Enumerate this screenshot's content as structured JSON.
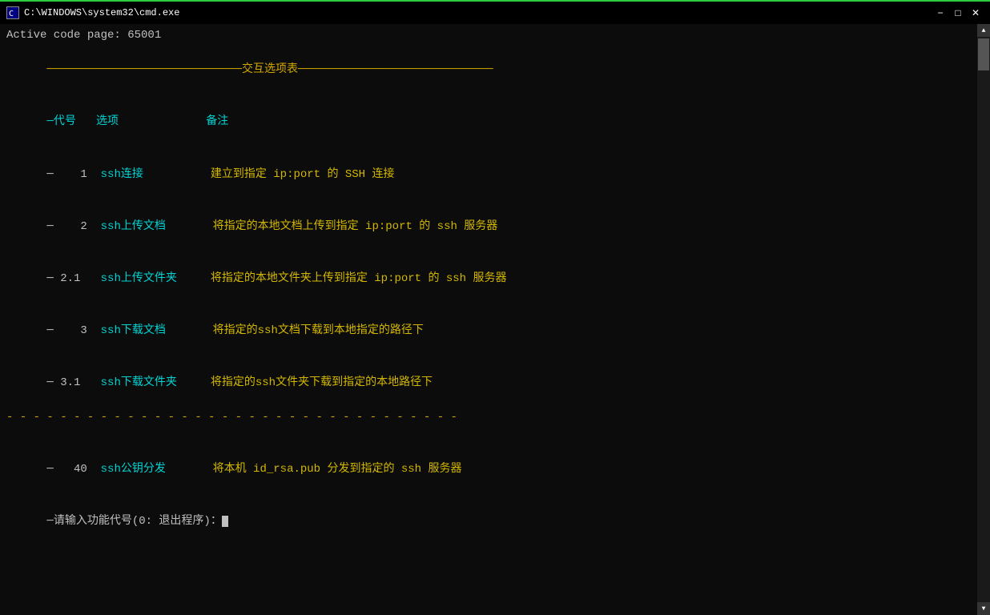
{
  "titlebar": {
    "title": "C:\\WINDOWS\\system32\\cmd.exe",
    "icon_label": "C",
    "minimize_label": "−",
    "restore_label": "□",
    "close_label": "✕"
  },
  "terminal": {
    "active_code": "Active code page: 65001",
    "menu_title": "─────────────────────────────交互选项表─────────────────────────────",
    "header_row": "─代号   选项             备注",
    "rows": [
      {
        "code": "─    1",
        "option": "ssh连接",
        "desc": "建立到指定 ip:port 的 SSH 连接"
      },
      {
        "code": "─    2",
        "option": "ssh上传文档",
        "desc": "将指定的本地文档上传到指定 ip:port 的 ssh 服务器"
      },
      {
        "code": "─ 2.1",
        "option": "ssh上传文件夹",
        "desc": "将指定的本地文件夹上传到指定 ip:port 的 ssh 服务器"
      },
      {
        "code": "─    3",
        "option": "ssh下载文档",
        "desc": "将指定的ssh文档下载到本地指定的路径下"
      },
      {
        "code": "─ 3.1",
        "option": "ssh下载文件夹",
        "desc": "将指定的ssh文件夹下载到指定的本地路径下"
      }
    ],
    "separator": "- - - - - - - - - - - - - - - - - - - - - - - - - - - - - - - - - -",
    "extra_rows": [
      {
        "code": "─   40",
        "option": "ssh公钥分发",
        "desc": "将本机 id_rsa.pub 分发到指定的 ssh 服务器"
      }
    ],
    "prompt": "─请输入功能代号(0: 退出程序)："
  }
}
